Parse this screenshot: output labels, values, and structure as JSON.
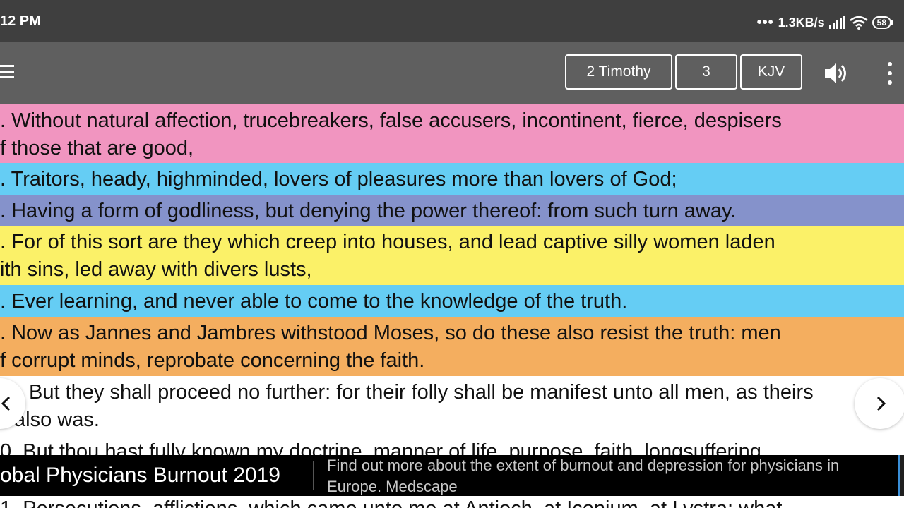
{
  "status_bar": {
    "time": "12 PM",
    "network_speed": "1.3KB/s",
    "battery": "58",
    "icons": [
      "more-dots-icon",
      "signal-icon",
      "wifi-icon",
      "battery-icon"
    ]
  },
  "toolbar": {
    "book": "2 Timothy",
    "chapter": "3",
    "version": "KJV",
    "icons": [
      "hamburger-menu-icon",
      "speaker-icon",
      "overflow-menu-icon"
    ]
  },
  "verses": [
    {
      "color": "#f195c0",
      "lines": [
        ". Without natural affection, trucebreakers, false accusers, incontinent, fierce, despisers",
        "f those that are good,"
      ]
    },
    {
      "color": "#65cdf4",
      "lines": [
        ". Traitors, heady, highminded, lovers of pleasures more than lovers of God;"
      ]
    },
    {
      "color": "#8592cb",
      "lines": [
        ". Having a form of godliness, but denying the power thereof: from such turn away."
      ]
    },
    {
      "color": "#fbf168",
      "lines": [
        ". For of this sort are they which creep into houses, and lead captive silly women laden",
        "ith sins, led away with divers lusts,"
      ]
    },
    {
      "color": "#65cdf4",
      "lines": [
        ". Ever learning, and never able to come to the knowledge of the truth."
      ]
    },
    {
      "color": "#f4ae5f",
      "lines": [
        ". Now as Jannes and Jambres withstood Moses, so do these also resist the truth: men",
        "f corrupt minds, reprobate concerning the faith."
      ]
    },
    {
      "color": "#ffffff",
      "lines": [
        "But they shall proceed no further: for their folly shall be manifest unto all men, as theirs",
        "also was."
      ]
    },
    {
      "color": "#ffffff",
      "lines": [
        "0. But thou hast fully known my doctrine, manner of life, purpose, faith, longsuffering,"
      ]
    },
    {
      "color": "#ffffff",
      "lines": [
        "1. Persecutions, afflictions, which came unto me at Antioch, at Iconium, at Lystra; what"
      ]
    }
  ],
  "ad": {
    "title": "obal Physicians Burnout 2019",
    "description": "Find out more about the extent of burnout and depression for physicians in Europe. Medscape"
  },
  "nav": {
    "icons": [
      "chevron-left-icon",
      "chevron-right-icon"
    ]
  }
}
